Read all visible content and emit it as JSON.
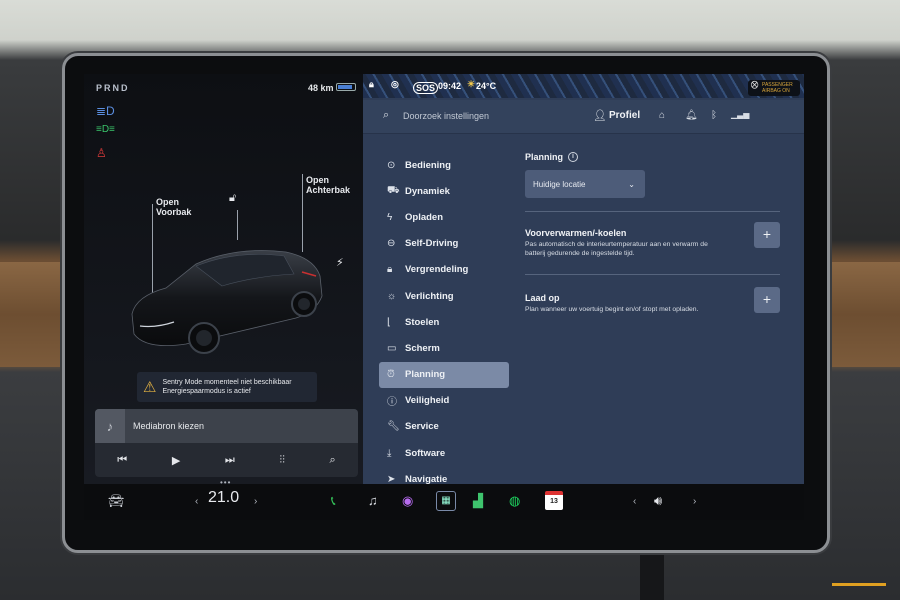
{
  "left": {
    "gear": "PRND",
    "range": "48 km",
    "front_trunk": [
      "Open",
      "Voorbak"
    ],
    "rear_trunk": [
      "Open",
      "Achterbak"
    ],
    "alert": {
      "line1": "Sentry Mode momenteel niet beschikbaar",
      "line2": "Energiespaarmodus is actief"
    },
    "media": {
      "source_label": "Mediabron kiezen"
    }
  },
  "status": {
    "sos": "SOS",
    "time": "09:42",
    "temp": "24°C",
    "airbag_line1": "PASSENGER",
    "airbag_line2": "AIRBAG ON"
  },
  "search": {
    "placeholder": "Doorzoek instellingen",
    "profile": "Profiel"
  },
  "menu": [
    {
      "label": "Bediening",
      "icon": "toggle-icon"
    },
    {
      "label": "Dynamiek",
      "icon": "car-icon"
    },
    {
      "label": "Opladen",
      "icon": "bolt-icon"
    },
    {
      "label": "Self-Driving",
      "icon": "steering-wheel-icon"
    },
    {
      "label": "Vergrendeling",
      "icon": "lock-icon"
    },
    {
      "label": "Verlichting",
      "icon": "sun-icon"
    },
    {
      "label": "Stoelen",
      "icon": "seat-icon"
    },
    {
      "label": "Scherm",
      "icon": "screen-icon"
    },
    {
      "label": "Planning",
      "icon": "alarm-clock-icon",
      "active": true
    },
    {
      "label": "Veiligheid",
      "icon": "info-circle-icon"
    },
    {
      "label": "Service",
      "icon": "wrench-icon"
    },
    {
      "label": "Software",
      "icon": "download-icon"
    },
    {
      "label": "Navigatie",
      "icon": "navigation-icon"
    }
  ],
  "planning": {
    "heading": "Planning",
    "location_select": "Huidige locatie",
    "precondition": {
      "title": "Voorverwarmen/-koelen",
      "desc": "Pas automatisch de interieurtemperatuur aan en verwarm de batterij gedurende de ingestelde tijd."
    },
    "charge": {
      "title": "Laad op",
      "desc": "Plan wanneer uw voertuig begint en/of stopt met opladen."
    },
    "plus": "+"
  },
  "taskbar": {
    "cabin_temp": "21.0",
    "calendar_day": "13"
  }
}
